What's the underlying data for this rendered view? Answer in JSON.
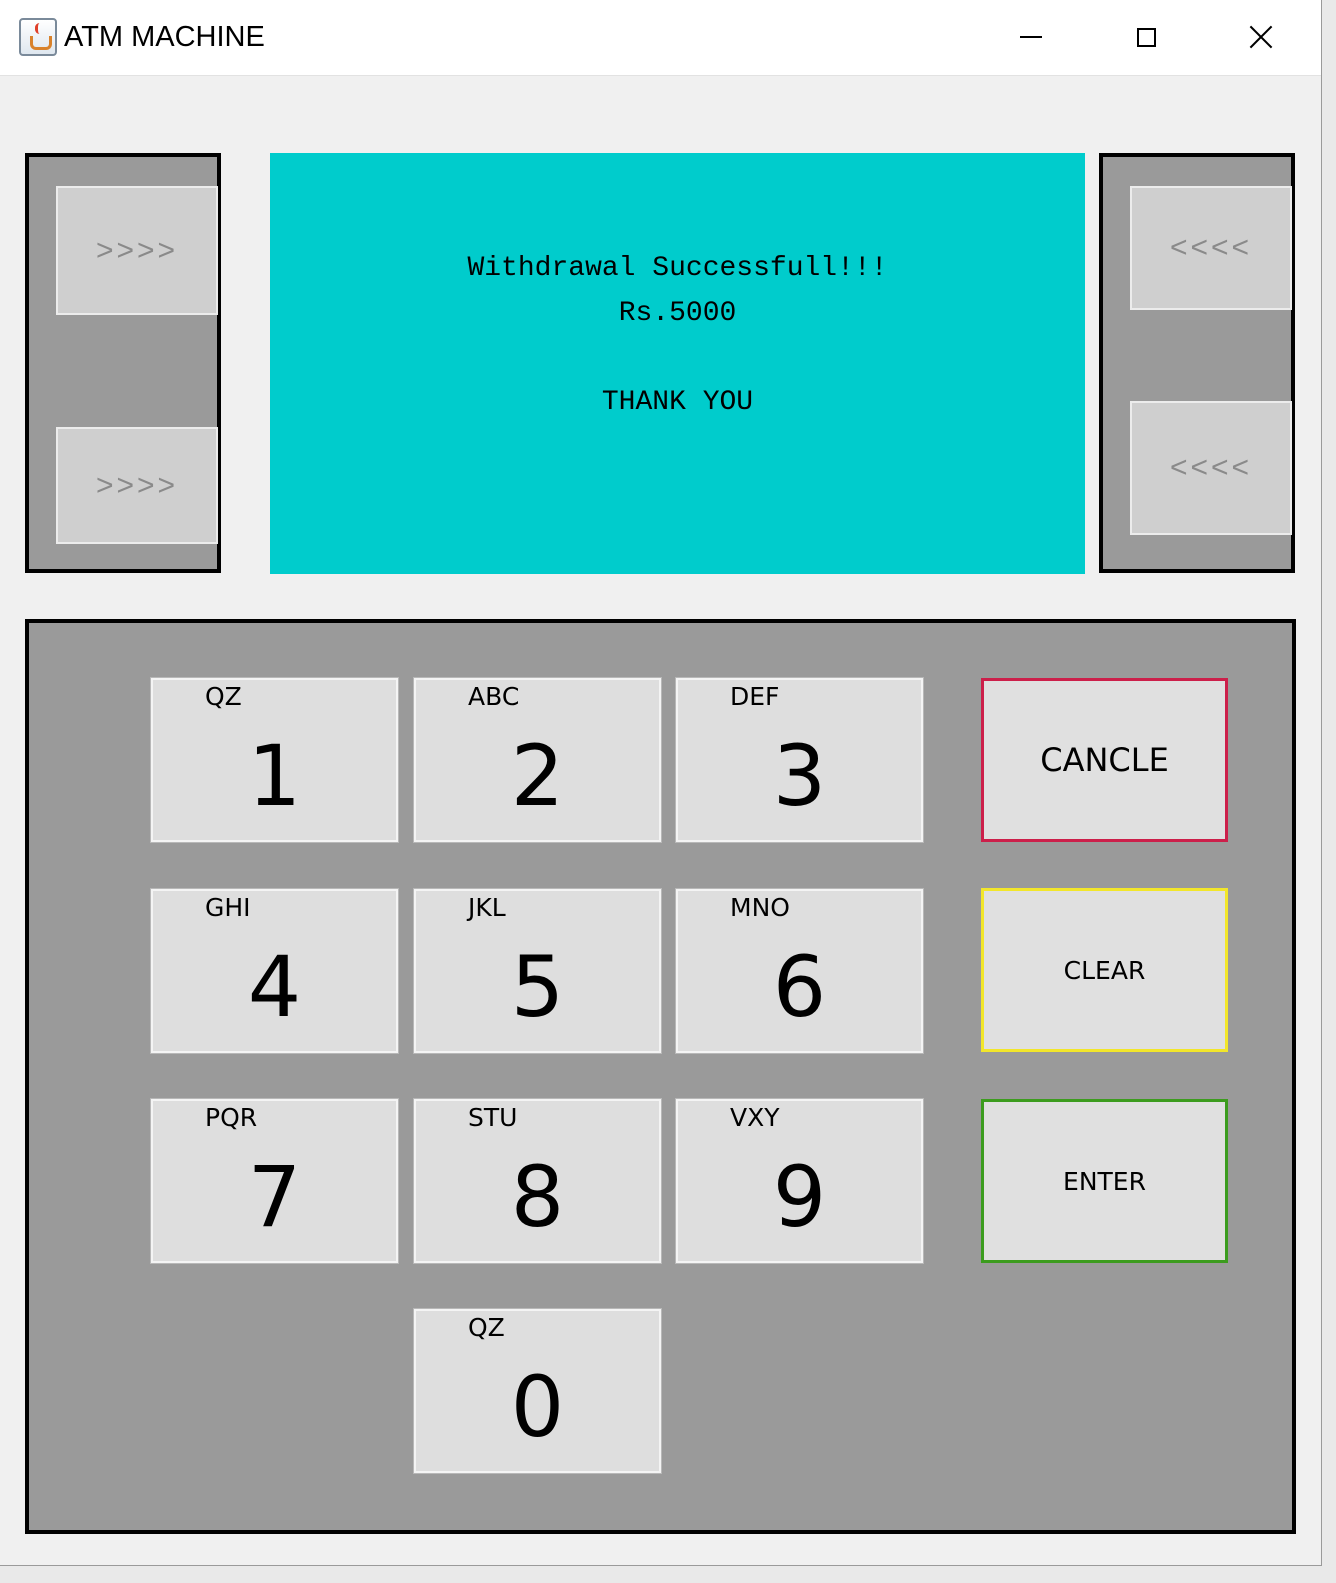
{
  "window": {
    "title": "ATM MACHINE"
  },
  "side_buttons": {
    "left_top": ">>>>",
    "left_bottom": ">>>>",
    "right_top": "<<<<",
    "right_bottom": "<<<<"
  },
  "screen": {
    "line1": "Withdrawal Successfull!!!",
    "line2": "Rs.5000",
    "line3": "THANK YOU",
    "background_color": "#00cccc"
  },
  "keypad": {
    "keys": [
      {
        "digit": "1",
        "letters": "QZ"
      },
      {
        "digit": "2",
        "letters": "ABC"
      },
      {
        "digit": "3",
        "letters": "DEF"
      },
      {
        "digit": "4",
        "letters": "GHI"
      },
      {
        "digit": "5",
        "letters": "JKL"
      },
      {
        "digit": "6",
        "letters": "MNO"
      },
      {
        "digit": "7",
        "letters": "PQR"
      },
      {
        "digit": "8",
        "letters": "STU"
      },
      {
        "digit": "9",
        "letters": "VXY"
      },
      {
        "digit": "0",
        "letters": "QZ"
      }
    ],
    "cancel_label": "CANCLE",
    "clear_label": "CLEAR",
    "enter_label": "ENTER",
    "cancel_color": "#cc1f4a",
    "clear_color": "#f2e62a",
    "enter_color": "#3c9c1e"
  },
  "icons": {
    "app": "java-cup-icon",
    "minimize": "minimize-icon",
    "maximize": "maximize-icon",
    "close": "close-icon"
  }
}
